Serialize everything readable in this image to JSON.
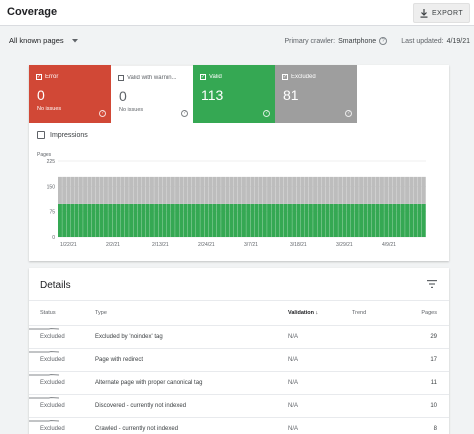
{
  "header": {
    "title": "Coverage",
    "export_label": "EXPORT"
  },
  "filters": {
    "pages_selector": "All known pages",
    "primary_crawler_label": "Primary crawler:",
    "primary_crawler_value": "Smartphone",
    "last_updated_label": "Last updated:",
    "last_updated_value": "4/19/21"
  },
  "tiles": [
    {
      "label": "Error",
      "count": "0",
      "sub": "No issues",
      "checked": true
    },
    {
      "label": "Valid with warnin...",
      "count": "0",
      "sub": "No issues",
      "checked": false
    },
    {
      "label": "Valid",
      "count": "113",
      "sub": "",
      "checked": true
    },
    {
      "label": "Excluded",
      "count": "81",
      "sub": "",
      "checked": true
    }
  ],
  "impressions_label": "Impressions",
  "chart_data": {
    "type": "bar",
    "ylabel": "Pages",
    "yticks": [
      0,
      75,
      150,
      225
    ],
    "ylim": [
      0,
      225
    ],
    "grid": true,
    "xtick_labels": [
      "1/22/21",
      "2/2/21",
      "2/13/21",
      "2/24/21",
      "3/7/21",
      "3/18/21",
      "3/29/21",
      "4/9/21"
    ],
    "series": [
      {
        "name": "Valid",
        "color": "#35a853",
        "values": [
          98,
          98,
          98,
          98,
          98,
          98,
          98,
          98,
          98,
          98,
          98,
          98,
          98,
          98,
          98,
          98,
          98,
          98,
          98,
          98,
          98,
          98,
          98,
          98,
          98,
          98,
          98,
          98,
          98,
          98,
          98,
          98,
          98,
          98,
          98,
          98,
          98,
          98,
          98,
          98,
          98,
          98,
          98,
          98,
          98,
          98,
          98,
          98,
          98,
          98,
          98,
          98,
          98,
          98,
          98,
          98,
          98,
          98,
          98,
          98,
          98,
          98,
          98,
          98,
          98,
          98,
          98,
          98,
          98,
          98,
          98,
          98,
          98,
          98,
          98,
          98,
          98,
          98,
          98,
          98,
          98,
          98,
          98,
          98,
          98,
          98,
          98,
          98
        ]
      },
      {
        "name": "Excluded",
        "color": "#bdbdbd",
        "values": [
          80,
          80,
          80,
          80,
          80,
          80,
          80,
          80,
          80,
          80,
          80,
          80,
          80,
          80,
          80,
          80,
          80,
          80,
          80,
          80,
          80,
          80,
          80,
          80,
          80,
          80,
          80,
          80,
          80,
          80,
          80,
          80,
          80,
          80,
          80,
          80,
          80,
          80,
          80,
          80,
          80,
          80,
          80,
          80,
          80,
          80,
          80,
          80,
          80,
          80,
          80,
          80,
          80,
          80,
          80,
          80,
          80,
          80,
          80,
          80,
          80,
          80,
          80,
          80,
          80,
          80,
          80,
          80,
          80,
          80,
          80,
          80,
          80,
          80,
          80,
          80,
          80,
          80,
          80,
          80,
          80,
          80,
          80,
          80,
          80,
          80,
          80,
          80
        ]
      }
    ]
  },
  "details": {
    "title": "Details",
    "columns": {
      "status": "Status",
      "type": "Type",
      "validation": "Validation",
      "trend": "Trend",
      "pages": "Pages"
    },
    "rows": [
      {
        "status": "Excluded",
        "type": "Excluded by 'noindex' tag",
        "validation": "N/A",
        "pages": "29"
      },
      {
        "status": "Excluded",
        "type": "Page with redirect",
        "validation": "N/A",
        "pages": "17"
      },
      {
        "status": "Excluded",
        "type": "Alternate page with proper canonical tag",
        "validation": "N/A",
        "pages": "11"
      },
      {
        "status": "Excluded",
        "type": "Discovered - currently not indexed",
        "validation": "N/A",
        "pages": "10"
      },
      {
        "status": "Excluded",
        "type": "Crawled - currently not indexed",
        "validation": "N/A",
        "pages": "8"
      }
    ]
  }
}
